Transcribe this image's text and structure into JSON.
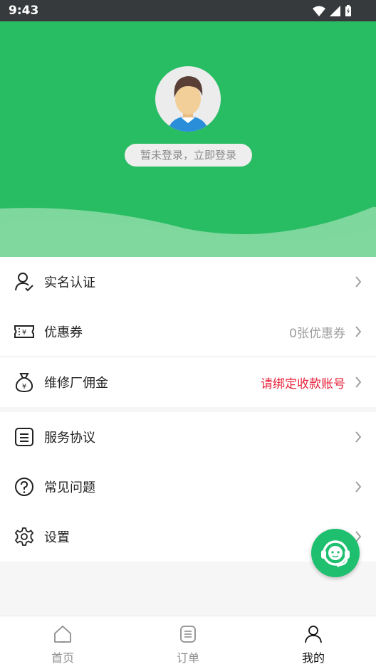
{
  "status_bar": {
    "time": "9:43"
  },
  "profile": {
    "login_prompt": "暂未登录，立即登录"
  },
  "menu": {
    "group1": [
      {
        "label": "实名认证",
        "value": "",
        "icon": "user-verify-icon"
      },
      {
        "label": "优惠券",
        "value": "0张优惠券",
        "icon": "ticket-icon"
      },
      {
        "label": "维修厂佣金",
        "value": "请绑定收款账号",
        "value_color": "#e8233b",
        "icon": "money-bag-icon"
      }
    ],
    "group2": [
      {
        "label": "服务协议",
        "icon": "document-icon"
      },
      {
        "label": "常见问题",
        "icon": "question-icon"
      },
      {
        "label": "设置",
        "icon": "gear-icon"
      }
    ]
  },
  "tabbar": {
    "items": [
      {
        "label": "首页",
        "icon": "home-icon",
        "active": false
      },
      {
        "label": "订单",
        "icon": "order-icon",
        "active": false
      },
      {
        "label": "我的",
        "icon": "person-icon",
        "active": true
      }
    ]
  },
  "colors": {
    "brand_green": "#29bd63",
    "warning_red": "#e8233b"
  }
}
